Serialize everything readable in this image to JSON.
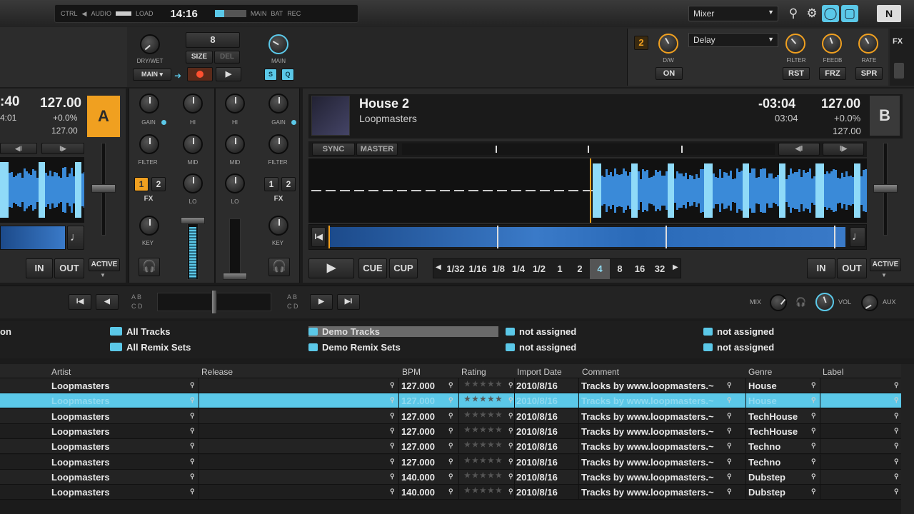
{
  "header": {
    "status_ctrl": "CTRL",
    "status_audio": "AUDIO",
    "status_load": "LOAD",
    "clock": "14:16",
    "status_main": "MAIN",
    "status_bat": "BAT",
    "status_rec": "REC",
    "layout_select": "Mixer",
    "ni_logo": "N"
  },
  "fx_top": {
    "drywet_label": "DRY/WET",
    "main_label": "MAIN",
    "size_value": "8",
    "size_label": "SIZE",
    "del_label": "DEL",
    "main_knob_label": "MAIN",
    "s_label": "S",
    "q_label": "Q"
  },
  "fx_unit": {
    "unit_number": "2",
    "dw_label": "D/W",
    "on_label": "ON",
    "effect_select": "Delay",
    "filter_label": "FILTER",
    "feedb_label": "FEEDB",
    "rate_label": "RATE",
    "rst_label": "RST",
    "frz_label": "FRZ",
    "spr_label": "SPR",
    "fx_tab": "FX"
  },
  "deck_a": {
    "time_remaining": ":40",
    "time_elapsed": "4:01",
    "bpm": "127.00",
    "pitch": "+0.0%",
    "tempo": "127.00",
    "letter": "A",
    "in_label": "IN",
    "out_label": "OUT",
    "active_label": "ACTIVE"
  },
  "mixer": {
    "gain": "GAIN",
    "hi": "HI",
    "mid": "MID",
    "lo": "LO",
    "filter": "FILTER",
    "key": "KEY",
    "fx": "FX",
    "fx1": "1",
    "fx2": "2"
  },
  "deck_b": {
    "title": "House 2",
    "artist": "Loopmasters",
    "time_remaining": "-03:04",
    "time_elapsed": "03:04",
    "bpm": "127.00",
    "pitch": "+0.0%",
    "tempo": "127.00",
    "letter": "B",
    "sync_label": "SYNC",
    "master_label": "MASTER",
    "cue_label": "CUE",
    "cup_label": "CUP",
    "in_label": "IN",
    "out_label": "OUT",
    "active_label": "ACTIVE",
    "loop_sizes": [
      "1/32",
      "1/16",
      "1/8",
      "1/4",
      "1/2",
      "1",
      "2",
      "4",
      "8",
      "16",
      "32"
    ],
    "active_loop": "4"
  },
  "transport": {
    "a_label": "A",
    "b_label": "B",
    "c_label": "C",
    "d_label": "D",
    "mix_label": "MIX",
    "vol_label": "VOL",
    "aux_label": "AUX"
  },
  "browser_tree": {
    "left_cut": "on",
    "all_tracks": "All Tracks",
    "all_remix_sets": "All Remix Sets",
    "demo_tracks": "Demo Tracks",
    "demo_remix_sets": "Demo Remix Sets",
    "not_assigned_1": "not assigned",
    "not_assigned_2": "not assigned",
    "not_assigned_3": "not assigned",
    "not_assigned_4": "not assigned"
  },
  "table": {
    "columns": [
      "Artist",
      "Release",
      "BPM",
      "Rating",
      "Import Date",
      "Comment",
      "Genre",
      "Label"
    ],
    "rows": [
      {
        "artist": "Loopmasters",
        "bpm": "127.000",
        "date": "2010/8/16",
        "comment": "Tracks by www.loopmasters.~",
        "genre": "House"
      },
      {
        "artist": "Loopmasters",
        "bpm": "127.000",
        "date": "2010/8/16",
        "comment": "Tracks by www.loopmasters.~",
        "genre": "House"
      },
      {
        "artist": "Loopmasters",
        "bpm": "127.000",
        "date": "2010/8/16",
        "comment": "Tracks by www.loopmasters.~",
        "genre": "TechHouse"
      },
      {
        "artist": "Loopmasters",
        "bpm": "127.000",
        "date": "2010/8/16",
        "comment": "Tracks by www.loopmasters.~",
        "genre": "TechHouse"
      },
      {
        "artist": "Loopmasters",
        "bpm": "127.000",
        "date": "2010/8/16",
        "comment": "Tracks by www.loopmasters.~",
        "genre": "Techno"
      },
      {
        "artist": "Loopmasters",
        "bpm": "127.000",
        "date": "2010/8/16",
        "comment": "Tracks by www.loopmasters.~",
        "genre": "Techno"
      },
      {
        "artist": "Loopmasters",
        "bpm": "140.000",
        "date": "2010/8/16",
        "comment": "Tracks by www.loopmasters.~",
        "genre": "Dubstep"
      },
      {
        "artist": "Loopmasters",
        "bpm": "140.000",
        "date": "2010/8/16",
        "comment": "Tracks by www.loopmasters.~",
        "genre": "Dubstep"
      }
    ],
    "selected_row": 1
  },
  "colors": {
    "accent_blue": "#5bc8e8",
    "accent_orange": "#f0a020",
    "waveform": "#4aa8e8"
  }
}
